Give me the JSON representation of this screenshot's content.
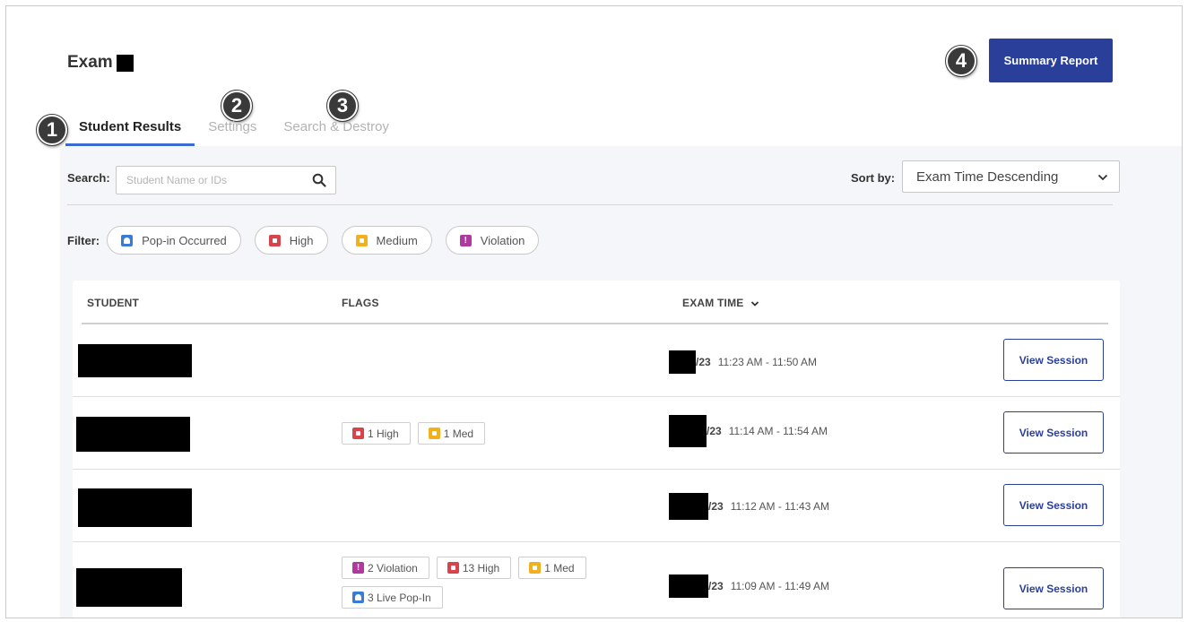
{
  "page": {
    "exam_label": "Exam",
    "summary_button": "Summary Report"
  },
  "markers": [
    "1",
    "2",
    "3",
    "4"
  ],
  "tabs": [
    {
      "label": "Student Results",
      "active": true
    },
    {
      "label": "Settings",
      "active": false
    },
    {
      "label": "Search & Destroy",
      "active": false
    }
  ],
  "search": {
    "label": "Search:",
    "placeholder": "Student Name or IDs",
    "value": ""
  },
  "sort": {
    "label": "Sort by:",
    "value": "Exam Time Descending"
  },
  "filter": {
    "label": "Filter:",
    "chips": [
      {
        "label": "Pop-in Occurred",
        "color": "#3a7bd5",
        "icon": "person-icon"
      },
      {
        "label": "High",
        "color": "#d9434b",
        "icon": "high-flag-icon"
      },
      {
        "label": "Medium",
        "color": "#f2b01e",
        "icon": "medium-flag-icon"
      },
      {
        "label": "Violation",
        "color": "#b0399e",
        "icon": "violation-icon"
      }
    ]
  },
  "table": {
    "headers": {
      "student": "STUDENT",
      "flags": "FLAGS",
      "exam_time": "EXAM TIME"
    },
    "rows": [
      {
        "date_tail": "/23",
        "time": "11:23 AM - 11:50 AM",
        "flags": [],
        "action": "View Session"
      },
      {
        "date_tail": "/23",
        "time": "11:14 AM - 11:54 AM",
        "flags": [
          {
            "label": "1 High",
            "type": "red"
          },
          {
            "label": "1 Med",
            "type": "amber"
          }
        ],
        "action": "View Session"
      },
      {
        "date_tail": "/23",
        "time": "11:12 AM - 11:43 AM",
        "flags": [],
        "action": "View Session"
      },
      {
        "date_tail": "/23",
        "time": "11:09 AM - 11:49 AM",
        "flags": [
          {
            "label": "2 Violation",
            "type": "purple"
          },
          {
            "label": "13 High",
            "type": "red"
          },
          {
            "label": "1 Med",
            "type": "amber"
          },
          {
            "label": "3 Live Pop-In",
            "type": "blue"
          }
        ],
        "action": "View Session"
      }
    ]
  },
  "colors": {
    "primary": "#2a3f9a",
    "tab_underline": "#3b6bd2",
    "panel_bg": "#f4f6f9"
  }
}
